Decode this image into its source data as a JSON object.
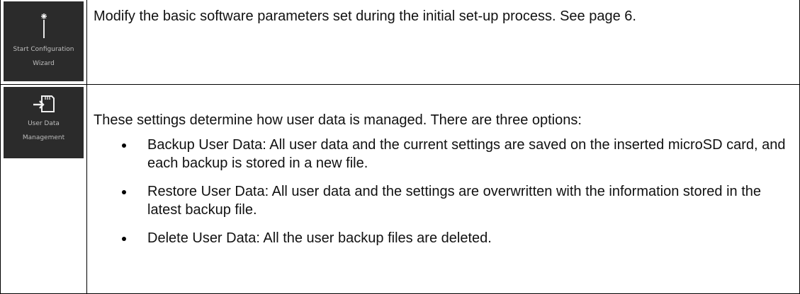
{
  "rows": [
    {
      "icon": {
        "name": "magic-wand-icon",
        "label_line1": "Start Configuration",
        "label_line2": "Wizard"
      },
      "text": "Modify the basic software parameters set during the initial set-up process. See page 6."
    },
    {
      "icon": {
        "name": "sd-card-import-icon",
        "label_line1": "User Data",
        "label_line2": "Management"
      },
      "intro": "These settings determine how user data is managed. There are three options:",
      "bullets": [
        " Backup User Data: All user data and the current settings are saved on the inserted microSD card, and each backup is stored in a new file.",
        "Restore User Data: All user data and the settings are overwritten with the information stored in the latest backup file.",
        "Delete User Data: All the user backup files are deleted."
      ]
    }
  ]
}
